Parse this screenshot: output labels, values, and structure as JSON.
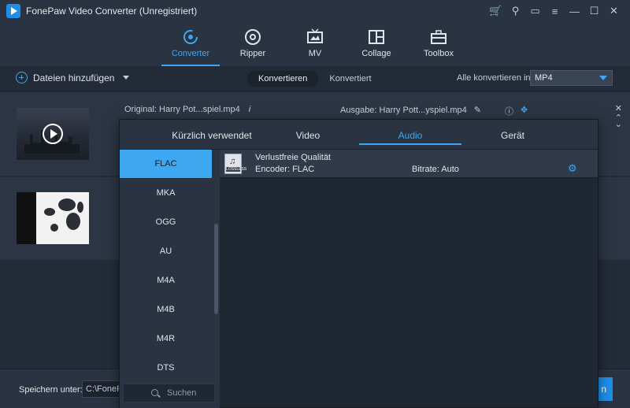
{
  "window": {
    "title": "FonePaw Video Converter (Unregistriert)",
    "icons": [
      "cart-icon",
      "key-icon",
      "chat-icon",
      "menu-icon",
      "minimize-icon",
      "maximize-icon",
      "close-icon"
    ]
  },
  "main_tabs": [
    {
      "label": "Converter",
      "icon": "converter-icon",
      "active": true
    },
    {
      "label": "Ripper",
      "icon": "disc-icon",
      "active": false
    },
    {
      "label": "MV",
      "icon": "tv-icon",
      "active": false
    },
    {
      "label": "Collage",
      "icon": "collage-icon",
      "active": false
    },
    {
      "label": "Toolbox",
      "icon": "toolbox-icon",
      "active": false
    }
  ],
  "toolbar": {
    "add_files_label": "Dateien hinzufügen",
    "segment_converting": "Konvertieren",
    "segment_converted": "Konvertiert",
    "convert_all_label": "Alle konvertieren in:",
    "convert_all_value": "MP4"
  },
  "file1": {
    "original": "Original: Harry Pot...spiel.mp4",
    "output": "Ausgabe: Harry Pott...yspiel.mp4"
  },
  "popup": {
    "tabs": [
      {
        "label": "Kürzlich verwendet",
        "active": false
      },
      {
        "label": "Video",
        "active": false
      },
      {
        "label": "Audio",
        "active": true
      },
      {
        "label": "Gerät",
        "active": false
      }
    ],
    "formats": [
      "FLAC",
      "MKA",
      "OGG",
      "AU",
      "M4A",
      "M4B",
      "M4R",
      "DTS"
    ],
    "selected_format": "FLAC",
    "search_placeholder": "Suchen",
    "preset": {
      "name": "Verlustfreie Qualität",
      "encoder": "Encoder: FLAC",
      "bitrate": "Bitrate: Auto",
      "icon_text": "LOSSLESS"
    }
  },
  "bottom": {
    "save_label": "Speichern unter:",
    "save_path": "C:\\FonePaw",
    "convert_button": "n"
  },
  "colors": {
    "accent": "#3da7f2",
    "background": "#232b38",
    "panel": "#2a3341"
  }
}
